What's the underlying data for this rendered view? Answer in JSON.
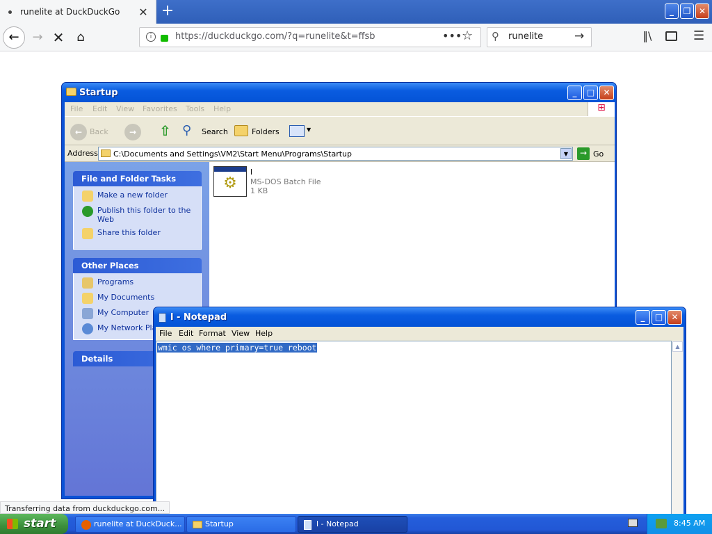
{
  "browser": {
    "tab_title": "runelite at DuckDuckGo",
    "url": "https://duckduckgo.com/?q=runelite&t=ffsb",
    "search_value": "runelite",
    "status_text": "Transferring data from duckduckgo.com..."
  },
  "explorer": {
    "title": "Startup",
    "menu": [
      "File",
      "Edit",
      "View",
      "Favorites",
      "Tools",
      "Help"
    ],
    "toolbar": {
      "back": "Back",
      "search": "Search",
      "folders": "Folders"
    },
    "address_label": "Address",
    "address_value": "C:\\Documents and Settings\\VM2\\Start Menu\\Programs\\Startup",
    "go_label": "Go",
    "panels": {
      "tasks_title": "File and Folder Tasks",
      "tasks": [
        "Make a new folder",
        "Publish this folder to the Web",
        "Share this folder"
      ],
      "places_title": "Other Places",
      "places": [
        "Programs",
        "My Documents",
        "My Computer",
        "My Network Places"
      ],
      "details_title": "Details"
    },
    "file": {
      "name": "l",
      "type": "MS-DOS Batch File",
      "size": "1 KB"
    }
  },
  "notepad": {
    "title": "l - Notepad",
    "menu": [
      "File",
      "Edit",
      "Format",
      "View",
      "Help"
    ],
    "content": "wmic os where primary=true reboot"
  },
  "taskbar": {
    "start_label": "start",
    "items": [
      "runelite at DuckDuck...",
      "Startup",
      "l - Notepad"
    ],
    "clock": "8:45 AM"
  }
}
